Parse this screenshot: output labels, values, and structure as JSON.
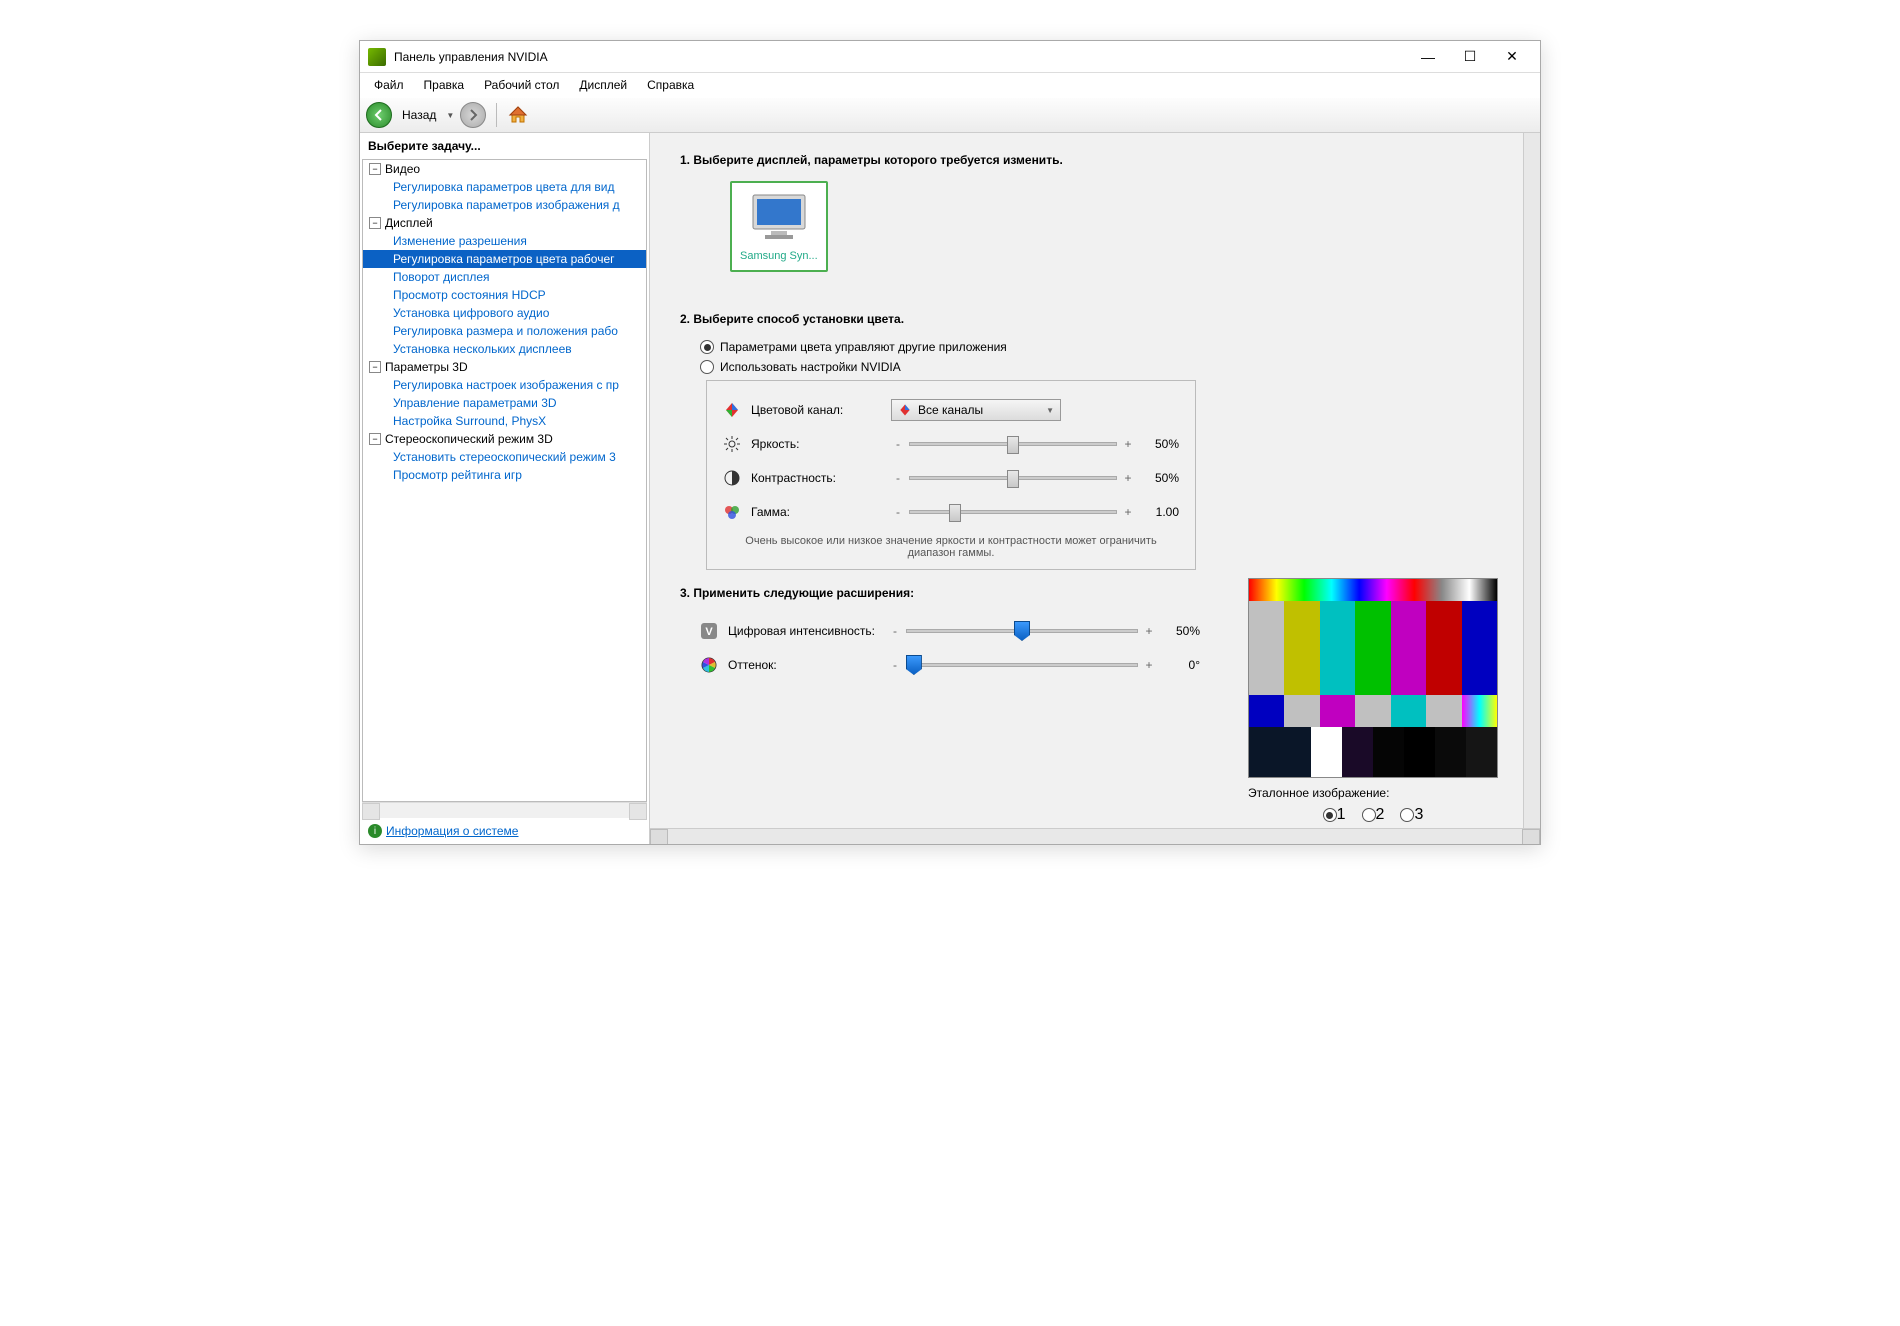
{
  "window": {
    "title": "Панель управления NVIDIA"
  },
  "menu": {
    "file": "Файл",
    "edit": "Правка",
    "desktop": "Рабочий стол",
    "display": "Дисплей",
    "help": "Справка"
  },
  "toolbar": {
    "back": "Назад"
  },
  "sidebar": {
    "heading": "Выберите задачу...",
    "video_cat": "Видео",
    "video_1": "Регулировка параметров цвета для вид",
    "video_2": "Регулировка параметров изображения д",
    "display_cat": "Дисплей",
    "display_1": "Изменение разрешения",
    "display_2": "Регулировка параметров цвета рабочег",
    "display_3": "Поворот дисплея",
    "display_4": "Просмотр состояния HDCP",
    "display_5": "Установка цифрового аудио",
    "display_6": "Регулировка размера и положения рабо",
    "display_7": "Установка нескольких дисплеев",
    "p3d_cat": "Параметры 3D",
    "p3d_1": "Регулировка настроек изображения с пр",
    "p3d_2": "Управление параметрами 3D",
    "p3d_3": "Настройка Surround, PhysX",
    "stereo_cat": "Стереоскопический режим 3D",
    "stereo_1": "Установить стереоскопический режим 3",
    "stereo_2": "Просмотр рейтинга игр",
    "info_link": "Информация о системе"
  },
  "content": {
    "step1_title": "1. Выберите дисплей, параметры которого требуется изменить.",
    "display_card": "Samsung Syn...",
    "step2_title": "2. Выберите способ установки цвета.",
    "radio_other": "Параметрами цвета управляют другие приложения",
    "radio_nvidia": "Использовать настройки NVIDIA",
    "channel_label": "Цветовой канал:",
    "channel_value": "Все каналы",
    "brightness_label": "Яркость:",
    "brightness_value": "50%",
    "contrast_label": "Контрастность:",
    "contrast_value": "50%",
    "gamma_label": "Гамма:",
    "gamma_value": "1.00",
    "box_note": "Очень высокое или низкое значение яркости и контрастности может ограничить диапазон гаммы.",
    "step3_title": "3. Применить следующие расширения:",
    "vibrance_label": "Цифровая интенсивность:",
    "vibrance_value": "50%",
    "hue_label": "Оттенок:",
    "hue_value": "0°",
    "ref_label": "Эталонное изображение:",
    "ref1": "1",
    "ref2": "2",
    "ref3": "3"
  }
}
